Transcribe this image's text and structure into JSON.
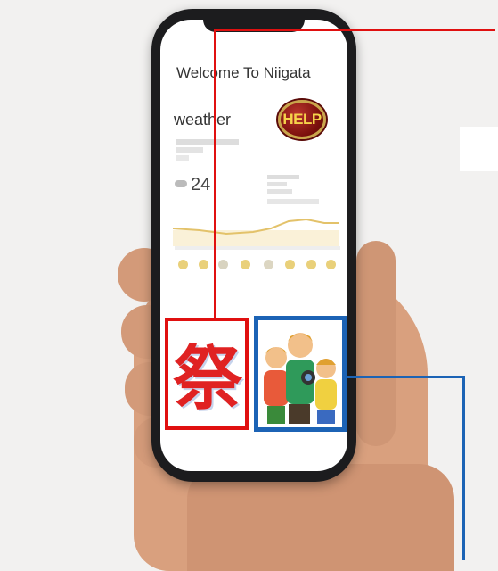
{
  "screen": {
    "title": "Welcome To Niigata",
    "weather_label": "weather",
    "help_label": "HELP",
    "temperature": "24",
    "festival_kanji": "祭"
  },
  "colors": {
    "festival_frame": "#e01010",
    "tourists_frame": "#1c63b5",
    "help_button": "#7a0f0c",
    "help_text": "#f6d34a"
  },
  "icons": [
    "help-icon",
    "festival-icon",
    "tourists-icon",
    "cloud-icon",
    "sun-icon"
  ]
}
